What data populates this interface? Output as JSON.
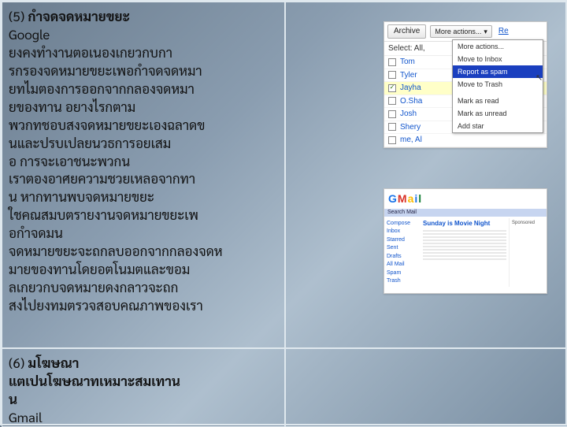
{
  "section5": {
    "number": "(5)",
    "title": "กำจดจดหมายขยะ",
    "company": "Google",
    "body": "ยงคงทำงานตอเนองเกยวกบกา\nรกรองจดหมายขยะเพอกำจดจดหมา\nยทไมตองการออกจากกลองจดหมา\nยของทาน อยางไรกตาม\nพวกทชอบสงจดหมายขยะเองฉลาดข\nนและปรบเปลยนวธการอยเสม\nอ การจะเอาชนะพวกน\nเราตองอาศยความชวยเหลอจากทา\nน หากทานพบจดหมายขยะ\nใชคณสมบตรายงานจดหมายขยะเพ\nอกำจดมน\nจดหมายขยะจะถกลบออกจากกลองจดห\nมายของทานโดยอตโนมตและขอม\nลเกยวกบจดหมายดงกลาวจะถก\nสงไปยงทมตรวจสอบคณภาพของเรา"
  },
  "section6": {
    "number": "(6)",
    "title": "มโฆษณา",
    "subtitle": "แตเปนโฆษณาทเหมาะสมเทาน\nน",
    "company": "Gmail"
  },
  "panel1": {
    "archive": "Archive",
    "more_actions": "More actions...",
    "re": "Re",
    "select": "Select: All,",
    "names": [
      "Tom",
      "Tyler",
      "Jayha",
      "O.Sha",
      "Josh",
      "Shery",
      "me, Al"
    ],
    "menu": {
      "more": "More actions...",
      "inbox": "Move to Inbox",
      "spam": "Report as spam",
      "trash": "Move to Trash",
      "read": "Mark as read",
      "unread": "Mark as unread",
      "star": "Add star"
    }
  },
  "panel2": {
    "logo": "GMail",
    "bar": "Search Mail",
    "header": "Sunday is Movie Night",
    "sidelinks": [
      "Compose",
      "Inbox",
      "Starred",
      "Sent",
      "Drafts",
      "All Mail",
      "Spam",
      "Trash"
    ],
    "ads_title": "Sponsored"
  }
}
